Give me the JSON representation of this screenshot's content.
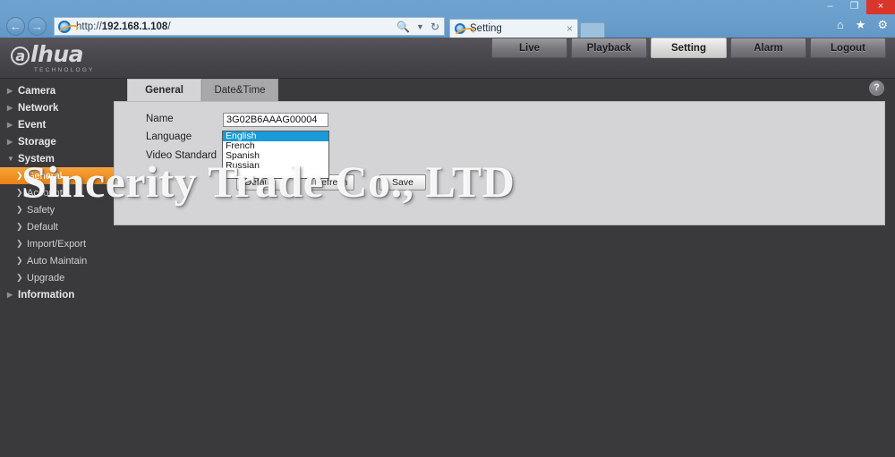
{
  "browser": {
    "url_scheme": "http://",
    "url_host": "192.168.1.108",
    "url_path": "/",
    "back_icon": "back-arrow-icon",
    "forward_icon": "forward-arrow-icon",
    "search_icon": "search-magnifier-icon",
    "dropdown_icon": "chevron-down-icon",
    "refresh_icon": "refresh-icon",
    "tab_title": "Setting",
    "tab_close": "×",
    "minimize": "–",
    "maximize": "❐",
    "close": "×",
    "home_icon": "⌂",
    "favorites_icon": "★",
    "tools_icon": "⚙"
  },
  "header": {
    "logo_mark": "a",
    "logo_text": "lhua",
    "logo_sub": "TECHNOLOGY",
    "nav": [
      {
        "label": "Live",
        "active": false
      },
      {
        "label": "Playback",
        "active": false
      },
      {
        "label": "Setting",
        "active": true
      },
      {
        "label": "Alarm",
        "active": false
      },
      {
        "label": "Logout",
        "active": false
      }
    ]
  },
  "sidebar": {
    "items": [
      {
        "label": "Camera",
        "level": "top",
        "state": "collapsed"
      },
      {
        "label": "Network",
        "level": "top",
        "state": "collapsed"
      },
      {
        "label": "Event",
        "level": "top",
        "state": "collapsed"
      },
      {
        "label": "Storage",
        "level": "top",
        "state": "collapsed"
      },
      {
        "label": "System",
        "level": "top",
        "state": "expanded"
      },
      {
        "label": "General",
        "level": "sub",
        "state": "active"
      },
      {
        "label": "Account",
        "level": "sub",
        "state": "normal"
      },
      {
        "label": "Safety",
        "level": "sub",
        "state": "normal"
      },
      {
        "label": "Default",
        "level": "sub",
        "state": "normal"
      },
      {
        "label": "Import/Export",
        "level": "sub",
        "state": "normal"
      },
      {
        "label": "Auto Maintain",
        "level": "sub",
        "state": "normal"
      },
      {
        "label": "Upgrade",
        "level": "sub",
        "state": "normal"
      },
      {
        "label": "Information",
        "level": "top",
        "state": "collapsed"
      }
    ]
  },
  "content": {
    "tabs": [
      {
        "label": "General",
        "selected": true
      },
      {
        "label": "Date&Time",
        "selected": false
      }
    ],
    "help_label": "?",
    "fields": {
      "name_label": "Name",
      "name_value": "3G02B6AAAG00004",
      "language_label": "Language",
      "language_value": "English",
      "video_standard_label": "Video Standard"
    },
    "language_options": [
      "English",
      "French",
      "Spanish",
      "Russian"
    ],
    "buttons": [
      {
        "label": "Default"
      },
      {
        "label": "Refresh"
      },
      {
        "label": "Save"
      }
    ]
  },
  "watermark": {
    "text": "Sincerity Trade Co., LTD"
  },
  "colors": {
    "accent_orange": "#ef8f20",
    "panel_gray": "#d4d4d6",
    "app_dark": "#3a393c",
    "browser_blue": "#6a9ecb",
    "select_blue": "#1a9ad6",
    "close_red": "#d9362b"
  }
}
